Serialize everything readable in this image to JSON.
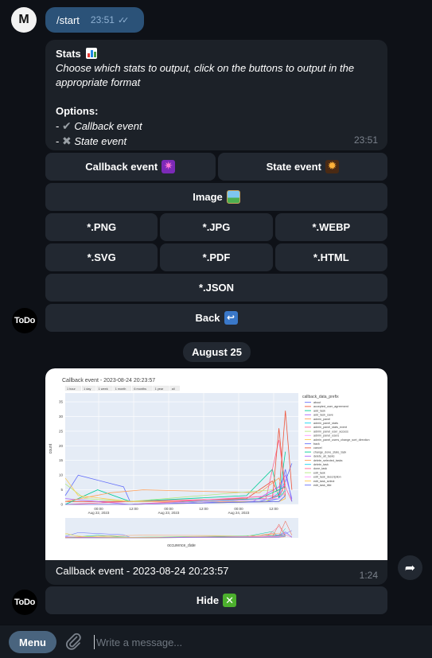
{
  "user_avatar": {
    "initial": "M"
  },
  "bot_avatar": {
    "label": "ToDo"
  },
  "outgoing": {
    "text": "/start",
    "time": "23:51",
    "ticks": "✓✓"
  },
  "stats_message": {
    "title": "Stats",
    "description": "Choose which stats to output, click on the buttons to output in the appropriate format",
    "options_label": "Options:",
    "options": [
      {
        "prefix": "- ",
        "mark": "✔",
        "label": "Callback event",
        "checked": true
      },
      {
        "prefix": "- ",
        "mark": "✖",
        "label": "State event",
        "checked": false
      }
    ],
    "time": "23:51"
  },
  "keyboard": {
    "callback_event": "Callback event",
    "state_event": "State event",
    "image": "Image",
    "png": "*.PNG",
    "jpg": "*.JPG",
    "webp": "*.WEBP",
    "svg": "*.SVG",
    "pdf": "*.PDF",
    "html": "*.HTML",
    "json": "*.JSON",
    "back": "Back",
    "back_icon": "↩"
  },
  "date_separator": "August 25",
  "photo_message": {
    "caption": "Callback event - 2023-08-24 20:23:57",
    "time": "1:24",
    "hide_button": "Hide",
    "hide_icon": "✕"
  },
  "chart_data": {
    "type": "line",
    "title": "Callback event - 2023-08-24 20:23:57",
    "range_buttons": [
      "1 hour",
      "1 day",
      "1 week",
      "1 month",
      "6 months",
      "1 year",
      "all"
    ],
    "xlabel": "occurence_date",
    "ylabel": "count",
    "ylim": [
      0,
      38
    ],
    "y_ticks": [
      0,
      5,
      10,
      15,
      20,
      25,
      30,
      35
    ],
    "x_tick_labels": [
      {
        "time": "00:00",
        "date": "Aug 22, 2023"
      },
      {
        "time": "12:00",
        "date": ""
      },
      {
        "time": "00:00",
        "date": "Aug 23, 2023"
      },
      {
        "time": "12:00",
        "date": ""
      },
      {
        "time": "00:00",
        "date": "Aug 24, 2023"
      },
      {
        "time": "12:00",
        "date": ""
      }
    ],
    "legend_title": "callback_data_prefix",
    "legend_placement": "right",
    "series": [
      {
        "name": "about",
        "color": "#636efa",
        "values": [
          [
            0,
            3
          ],
          [
            2,
            10
          ],
          [
            9,
            6
          ],
          [
            10,
            1
          ],
          [
            16,
            1
          ],
          [
            31,
            1
          ],
          [
            33,
            2
          ],
          [
            35,
            14
          ]
        ]
      },
      {
        "name": "accepted_user_agreement",
        "color": "#ef553b",
        "values": [
          [
            0,
            1
          ],
          [
            10,
            1
          ],
          [
            28,
            2
          ],
          [
            32,
            8
          ],
          [
            33,
            3
          ],
          [
            34,
            32
          ],
          [
            35,
            5
          ]
        ]
      },
      {
        "name": "add_task",
        "color": "#00cc96",
        "values": [
          [
            0,
            0
          ],
          [
            5,
            5
          ],
          [
            10,
            1
          ],
          [
            28,
            3
          ],
          [
            32,
            12
          ],
          [
            33,
            2
          ],
          [
            34,
            18
          ]
        ]
      },
      {
        "name": "add_task_save",
        "color": "#ab63fa",
        "values": [
          [
            0,
            2
          ],
          [
            10,
            0
          ],
          [
            29,
            1
          ],
          [
            33,
            6
          ],
          [
            34,
            10
          ],
          [
            35,
            2
          ]
        ]
      },
      {
        "name": "admin_panel",
        "color": "#ffa15a",
        "values": [
          [
            0,
            1
          ],
          [
            7,
            4
          ],
          [
            12,
            5
          ],
          [
            30,
            4
          ],
          [
            33,
            9
          ],
          [
            34,
            2
          ]
        ]
      },
      {
        "name": "admin_panel_stats",
        "color": "#19d3f3",
        "values": [
          [
            0,
            0
          ],
          [
            10,
            0
          ],
          [
            31,
            1
          ],
          [
            33,
            4
          ],
          [
            34,
            8
          ]
        ]
      },
      {
        "name": "admin_panel_stats_event",
        "color": "#ff6692",
        "values": [
          [
            0,
            0
          ],
          [
            10,
            1
          ],
          [
            31,
            2
          ],
          [
            33,
            22
          ],
          [
            34,
            6
          ],
          [
            35,
            1
          ]
        ]
      },
      {
        "name": "admin_panel_user_access",
        "color": "#b6e880",
        "values": [
          [
            0,
            7
          ],
          [
            3,
            2
          ],
          [
            10,
            1
          ],
          [
            32,
            5
          ],
          [
            34,
            3
          ]
        ]
      },
      {
        "name": "admin_panel_users",
        "color": "#ff97ff",
        "values": [
          [
            0,
            0
          ],
          [
            10,
            0
          ],
          [
            32,
            3
          ],
          [
            34,
            7
          ]
        ]
      },
      {
        "name": "admin_panel_users_change_sort_direction",
        "color": "#fecb52",
        "values": [
          [
            0,
            9
          ],
          [
            2,
            3
          ],
          [
            10,
            1
          ],
          [
            31,
            1
          ],
          [
            34,
            4
          ]
        ]
      },
      {
        "name": "back",
        "color": "#636efa",
        "values": [
          [
            0,
            0
          ],
          [
            10,
            0
          ],
          [
            30,
            1
          ],
          [
            33,
            3
          ],
          [
            34,
            12
          ],
          [
            35,
            1
          ]
        ]
      },
      {
        "name": "cancel",
        "color": "#ef553b",
        "values": [
          [
            0,
            0
          ],
          [
            10,
            0
          ],
          [
            32,
            2
          ],
          [
            33,
            26
          ],
          [
            34,
            3
          ]
        ]
      },
      {
        "name": "change_done_state_task",
        "color": "#00cc96",
        "values": [
          [
            0,
            0
          ],
          [
            10,
            0
          ],
          [
            30,
            2
          ],
          [
            34,
            6
          ]
        ]
      },
      {
        "name": "delete_all_tasks",
        "color": "#ab63fa",
        "values": [
          [
            0,
            0
          ],
          [
            10,
            0
          ],
          [
            33,
            2
          ],
          [
            34,
            4
          ]
        ]
      },
      {
        "name": "delete_selected_tasks",
        "color": "#ffa15a",
        "values": [
          [
            0,
            0
          ],
          [
            10,
            0
          ],
          [
            33,
            1
          ],
          [
            34,
            2
          ]
        ]
      },
      {
        "name": "delete_task",
        "color": "#19d3f3",
        "values": [
          [
            0,
            0
          ],
          [
            10,
            0
          ],
          [
            33,
            2
          ],
          [
            34,
            5
          ]
        ]
      },
      {
        "name": "done_task",
        "color": "#ff6692",
        "values": [
          [
            0,
            0
          ],
          [
            10,
            0
          ],
          [
            33,
            3
          ],
          [
            34,
            7
          ]
        ]
      },
      {
        "name": "edit_task",
        "color": "#b6e880",
        "values": [
          [
            0,
            0
          ],
          [
            10,
            0
          ],
          [
            33,
            1
          ],
          [
            34,
            3
          ]
        ]
      },
      {
        "name": "edit_task_description",
        "color": "#ff97ff",
        "values": [
          [
            0,
            0
          ],
          [
            10,
            0
          ],
          [
            33,
            2
          ],
          [
            34,
            4
          ]
        ]
      },
      {
        "name": "edit_task_select",
        "color": "#fecb52",
        "values": [
          [
            0,
            0
          ],
          [
            10,
            0
          ],
          [
            33,
            1
          ],
          [
            34,
            2
          ]
        ]
      },
      {
        "name": "edit_task_title",
        "color": "#636efa",
        "values": [
          [
            0,
            0
          ],
          [
            10,
            0
          ],
          [
            33,
            1
          ],
          [
            34,
            3
          ]
        ]
      }
    ]
  },
  "composer": {
    "menu_label": "Menu",
    "placeholder": "Write a message..."
  }
}
